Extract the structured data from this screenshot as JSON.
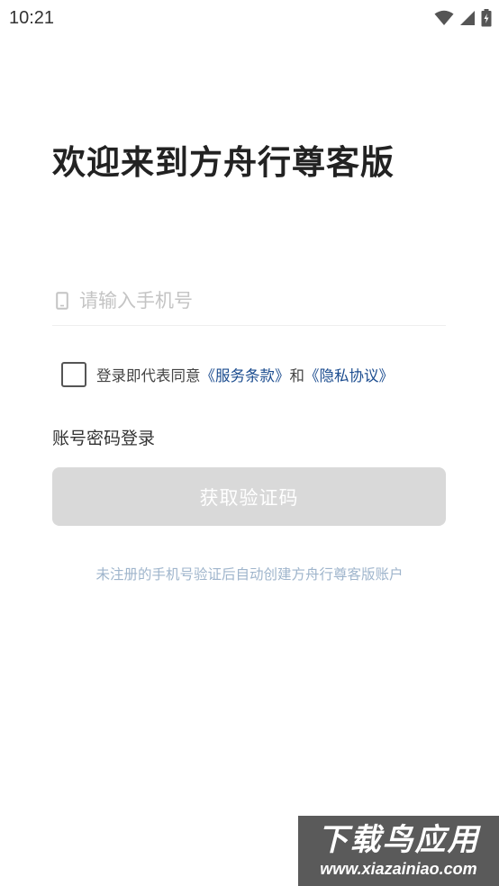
{
  "status_bar": {
    "time": "10:21",
    "icons": [
      "wifi-icon",
      "signal-icon",
      "battery-charging-icon"
    ]
  },
  "welcome": {
    "title": "欢迎来到方舟行尊客版"
  },
  "phone_input": {
    "placeholder": "请输入手机号",
    "value": "",
    "icon": "phone-icon"
  },
  "agreement": {
    "checked": false,
    "prefix": "登录即代表同意",
    "terms_link": "《服务条款》",
    "conjunction": "和",
    "privacy_link": "《隐私协议》"
  },
  "account_login_label": "账号密码登录",
  "get_code_button": {
    "label": "获取验证码",
    "enabled": false,
    "color": "#d9d9d9"
  },
  "hint": "未注册的手机号验证后自动创建方舟行尊客版账户",
  "watermark": {
    "title": "下载鸟应用",
    "url": "www.xiazainiao.com"
  },
  "colors": {
    "link": "#1b4c8f",
    "hint": "#9fb5cc",
    "placeholder": "#c4c4c4"
  }
}
